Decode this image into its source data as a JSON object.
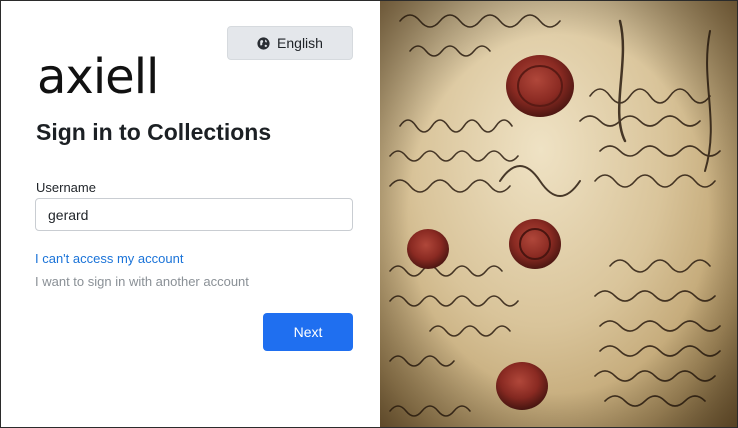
{
  "language": {
    "label": "English",
    "icon": "globe-icon"
  },
  "brand": {
    "logo_text": "axiell"
  },
  "form": {
    "title": "Sign in to Collections",
    "username_label": "Username",
    "username_value": "gerard",
    "cant_access_link": "I can't access my account",
    "other_account_link": "I want to sign in with another account",
    "next_label": "Next"
  },
  "colors": {
    "primary": "#1f6ff0",
    "link": "#1a73d8",
    "muted": "#8a9096"
  },
  "background_image": {
    "description_icon": "manuscript-with-wax-seals-image"
  }
}
